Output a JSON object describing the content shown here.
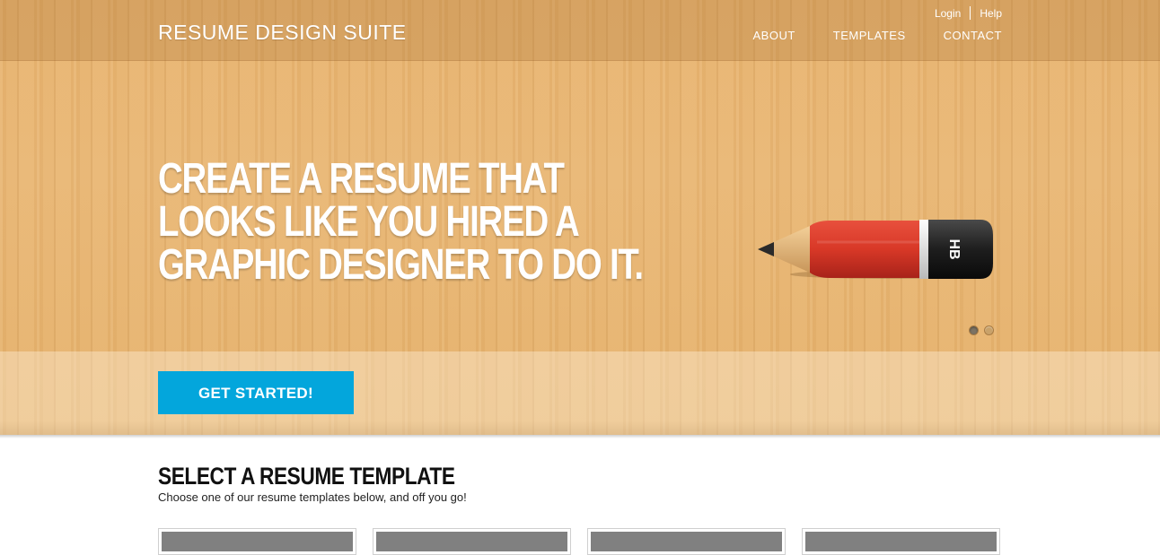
{
  "header": {
    "brand": "RESUME DESIGN SUITE",
    "util_links": [
      "Login",
      "Help"
    ],
    "nav": [
      "ABOUT",
      "TEMPLATES",
      "CONTACT"
    ]
  },
  "hero": {
    "headline_lines": [
      "CREATE A RESUME THAT",
      "LOOKS LIKE YOU HIRED A",
      "GRAPHIC DESIGNER TO DO IT."
    ],
    "pencil_label": "HB",
    "slider": {
      "count": 2,
      "active_index": 0
    },
    "cta_label": "GET STARTED!"
  },
  "templates_section": {
    "title": "SELECT A RESUME TEMPLATE",
    "subtitle": "Choose one of our resume templates below, and off you go!",
    "card_count": 4
  },
  "colors": {
    "cta": "#03a6dc",
    "wood": "#e8b46f",
    "pencil_body": "#d93a2b",
    "pencil_cap": "#222222"
  }
}
